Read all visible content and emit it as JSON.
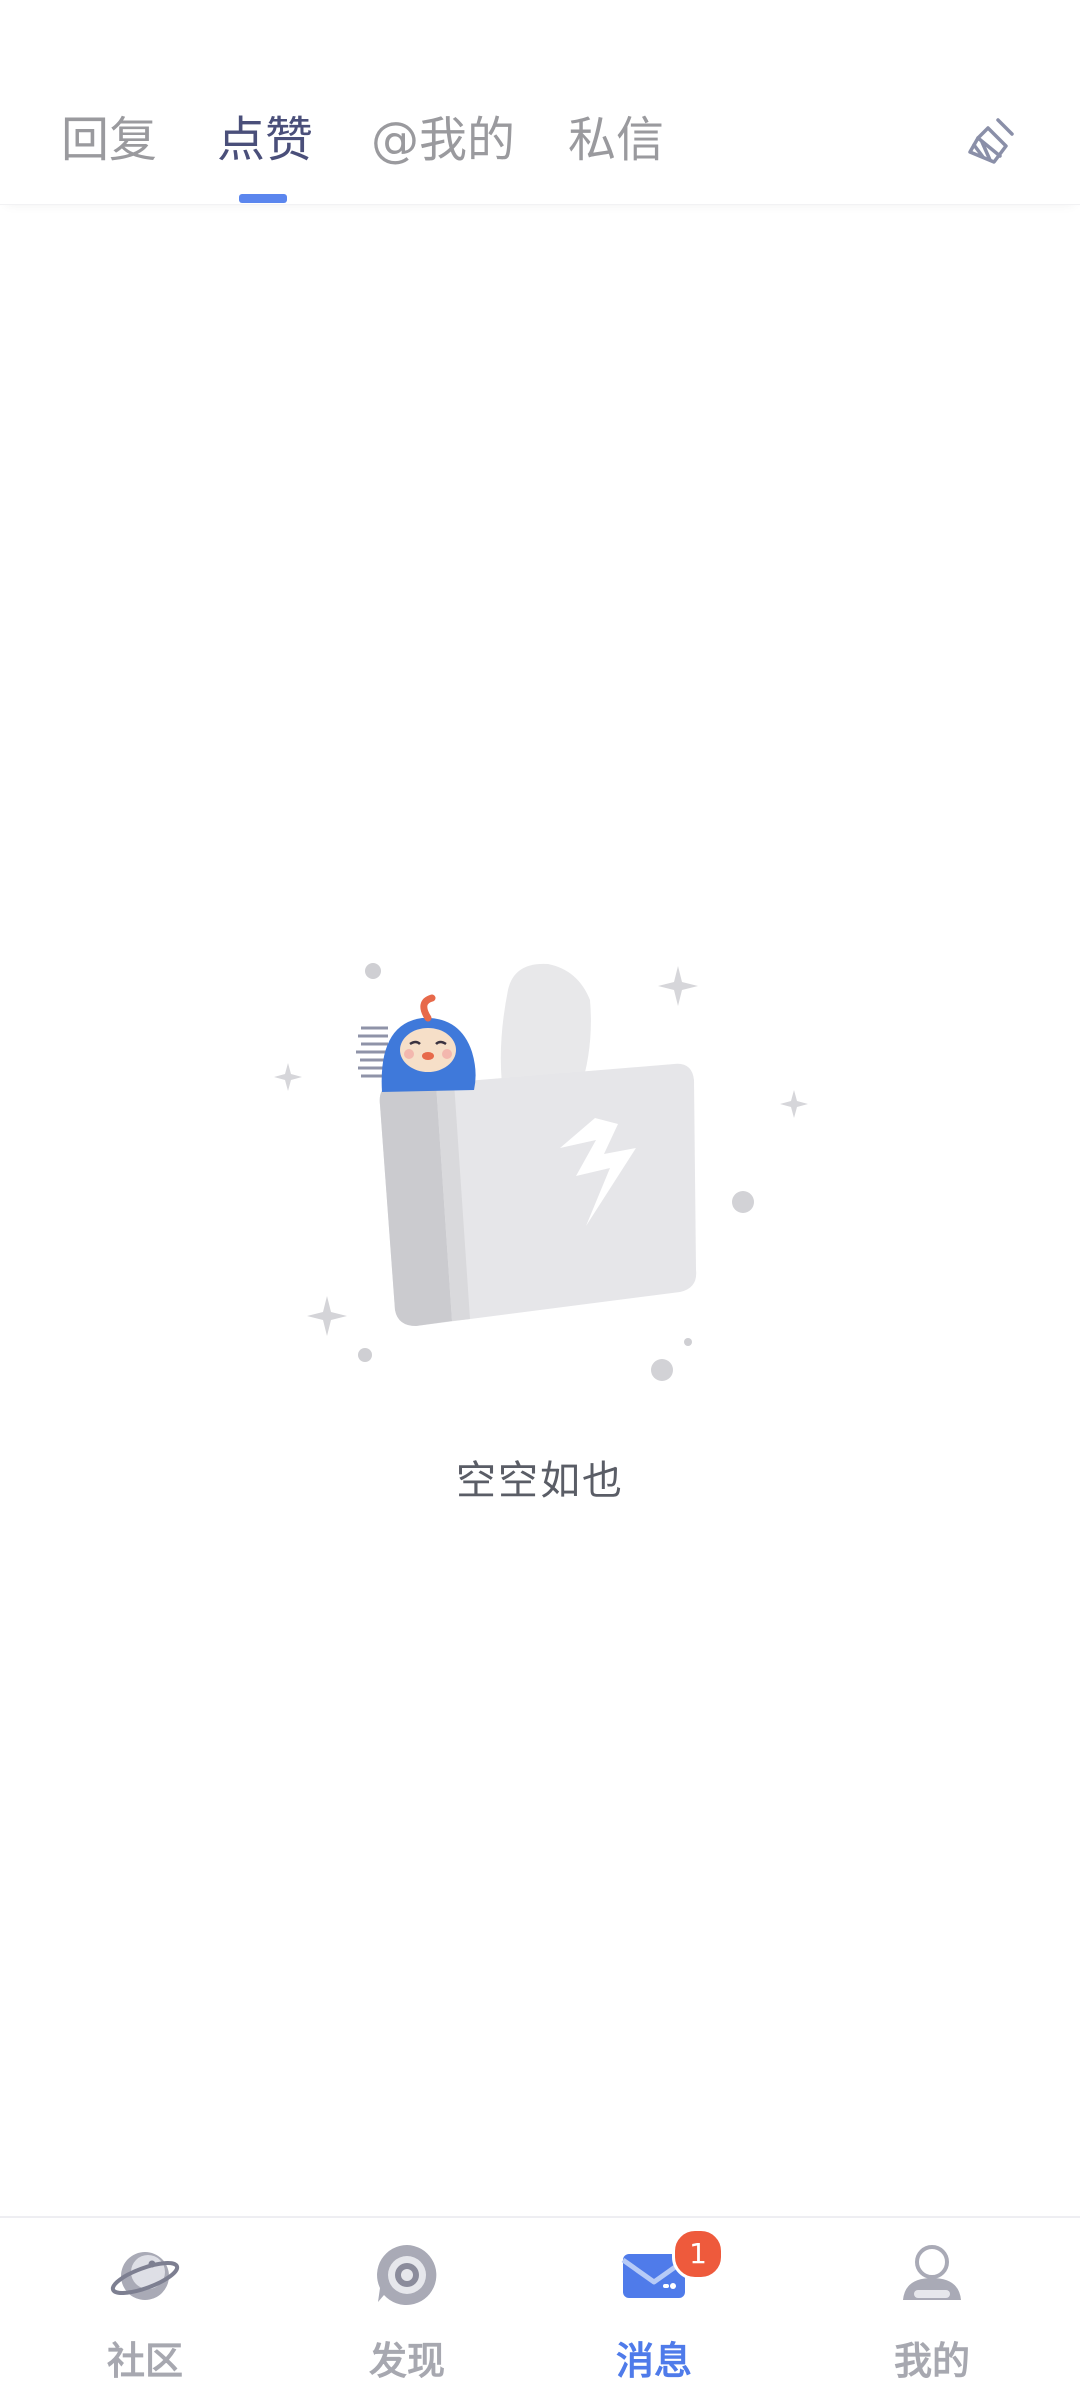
{
  "tabs": [
    {
      "label": "回复",
      "active": false
    },
    {
      "label": "点赞",
      "active": true
    },
    {
      "label": "@我的",
      "active": false
    },
    {
      "label": "私信",
      "active": false
    }
  ],
  "header": {
    "clear_icon": "broom-icon"
  },
  "empty_state": {
    "text": "空空如也",
    "illustration": "broken-thumbs-up-with-mascot"
  },
  "bottom_nav": {
    "items": [
      {
        "label": "社区",
        "icon": "planet-icon",
        "active": false
      },
      {
        "label": "发现",
        "icon": "target-icon",
        "active": false
      },
      {
        "label": "消息",
        "icon": "mail-icon",
        "active": true,
        "badge": "1"
      },
      {
        "label": "我的",
        "icon": "user-icon",
        "active": false
      }
    ]
  },
  "colors": {
    "accent": "#5b86ee",
    "active_tab_text": "#4a4f7a",
    "inactive_text": "#9a9a9e",
    "badge": "#ee5a3c",
    "nav_active": "#4f7bea",
    "nav_inactive": "#a7a8b0"
  }
}
